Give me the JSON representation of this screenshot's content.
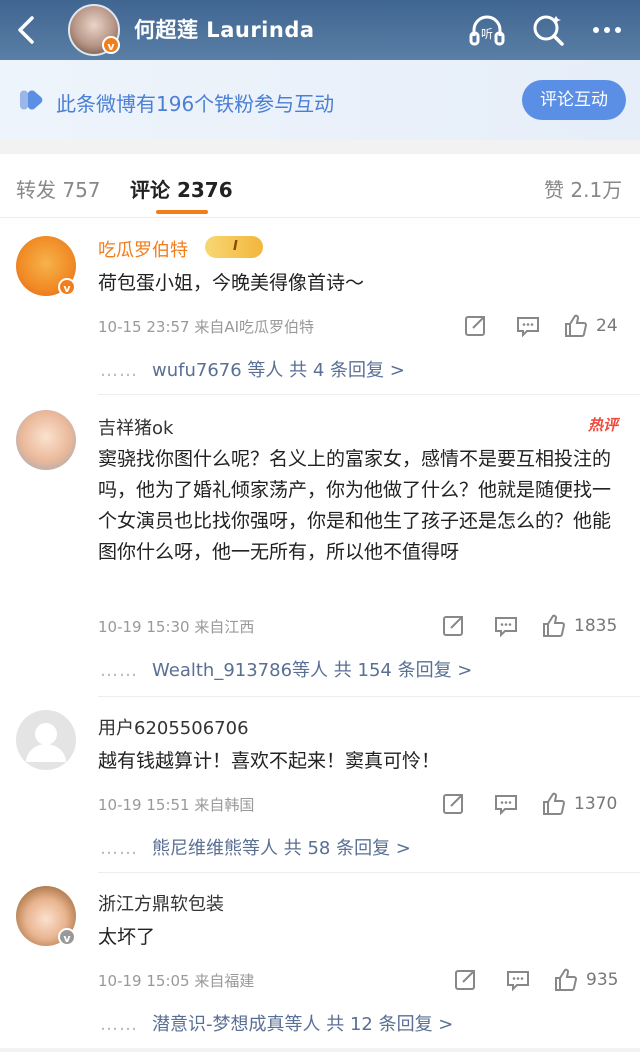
{
  "header": {
    "title": "何超莲 Laurinda",
    "back_icon": "chevron-left-icon",
    "listen_icon": "headphones-listen-icon",
    "listen_label": "听",
    "search_icon": "search-icon",
    "more_icon": "more-icon",
    "verified_mark": "v"
  },
  "banner": {
    "text": "此条微博有196个铁粉参与互动",
    "button_label": "评论互动"
  },
  "tabs": {
    "repost": "转发 757",
    "comments": "评论 2376",
    "likes": "赞 2.1万"
  },
  "colors": {
    "accent": "#f27d1b",
    "name_orange": "#f27d1b",
    "link_blue": "#5a6f94",
    "hot_red": "#f24a3d"
  },
  "comments": [
    {
      "name": "吃瓜罗伯特",
      "badge": "I",
      "text": "荷包蛋小姐，今晚美得像首诗～",
      "meta": "10-15 23:57  来自AI吃瓜罗伯特",
      "likes": "24",
      "replies_users": "wufu7676 等人",
      "replies_total": "共 4 条回复 >"
    },
    {
      "name": "吉祥猪ok",
      "hot": "热评",
      "text": "窦骁找你图什么呢？名义上的富家女，感情不是要互相投注的吗，他为了婚礼倾家荡产，你为他做了什么？他就是随便找一个女演员也比找你强呀，你是和他生了孩子还是怎么的？他能图你什么呀，他一无所有，所以他不值得呀",
      "meta": "10-19 15:30  来自江西",
      "likes": "1835",
      "replies_users": "Wealth_913786等人",
      "replies_total": "共 154 条回复 >"
    },
    {
      "name": "用户6205506706",
      "text": "越有钱越算计！喜欢不起来！窦真可怜！",
      "meta": "10-19 15:51  来自韩国",
      "likes": "1370",
      "replies_users": "熊尼维维熊等人",
      "replies_total": "共 58 条回复 >"
    },
    {
      "name": "浙江方鼎软包装",
      "text": "太坏了",
      "meta": "10-19 15:05  来自福建",
      "likes": "935",
      "replies_users": "潜意识-梦想成真等人",
      "replies_total": "共 12 条回复 >"
    }
  ]
}
